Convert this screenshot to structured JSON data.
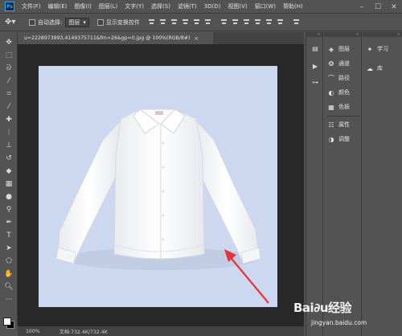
{
  "app": {
    "logo_text": "Ps"
  },
  "menu": [
    "文件(F)",
    "编辑(E)",
    "图像(I)",
    "图层(L)",
    "文字(Y)",
    "选择(S)",
    "滤镜(T)",
    "3D(D)",
    "视图(V)",
    "窗口(W)",
    "帮助(H)"
  ],
  "options": {
    "auto_select_label": "自动选择:",
    "auto_select_value": "图层",
    "show_transform_label": "显示变换控件"
  },
  "document": {
    "tab_title": "u=2228973993,4149375711&fm=26&gp=0.jpg @ 100%(RGB/8#)",
    "close_glyph": "×"
  },
  "status": {
    "zoom": "100%",
    "doc_size": "文档:732.4K/732.4K"
  },
  "panels": {
    "layers": "图层",
    "channels": "通道",
    "paths": "路径",
    "color": "颜色",
    "swatches": "色板",
    "properties": "属性",
    "adjustments": "调整",
    "learn": "学习",
    "libraries": "库"
  },
  "watermark": {
    "logo": "Bai∂u经验",
    "url": "jingyan.baidu.com"
  },
  "colors": {
    "canvas_bg": "#ccd7f0",
    "arrow": "#e8343a",
    "ui_gray": "#535353",
    "workspace": "#282828"
  },
  "icons": [
    "move-icon",
    "marquee-icon",
    "lasso-icon",
    "magic-wand-icon",
    "crop-icon",
    "eyedropper-icon",
    "healing-icon",
    "brush-icon",
    "stamp-icon",
    "history-brush-icon",
    "eraser-icon",
    "gradient-icon",
    "blur-icon",
    "dodge-icon",
    "pen-icon",
    "type-icon",
    "path-select-icon",
    "shape-icon",
    "hand-icon",
    "zoom-icon",
    "more-icon"
  ]
}
